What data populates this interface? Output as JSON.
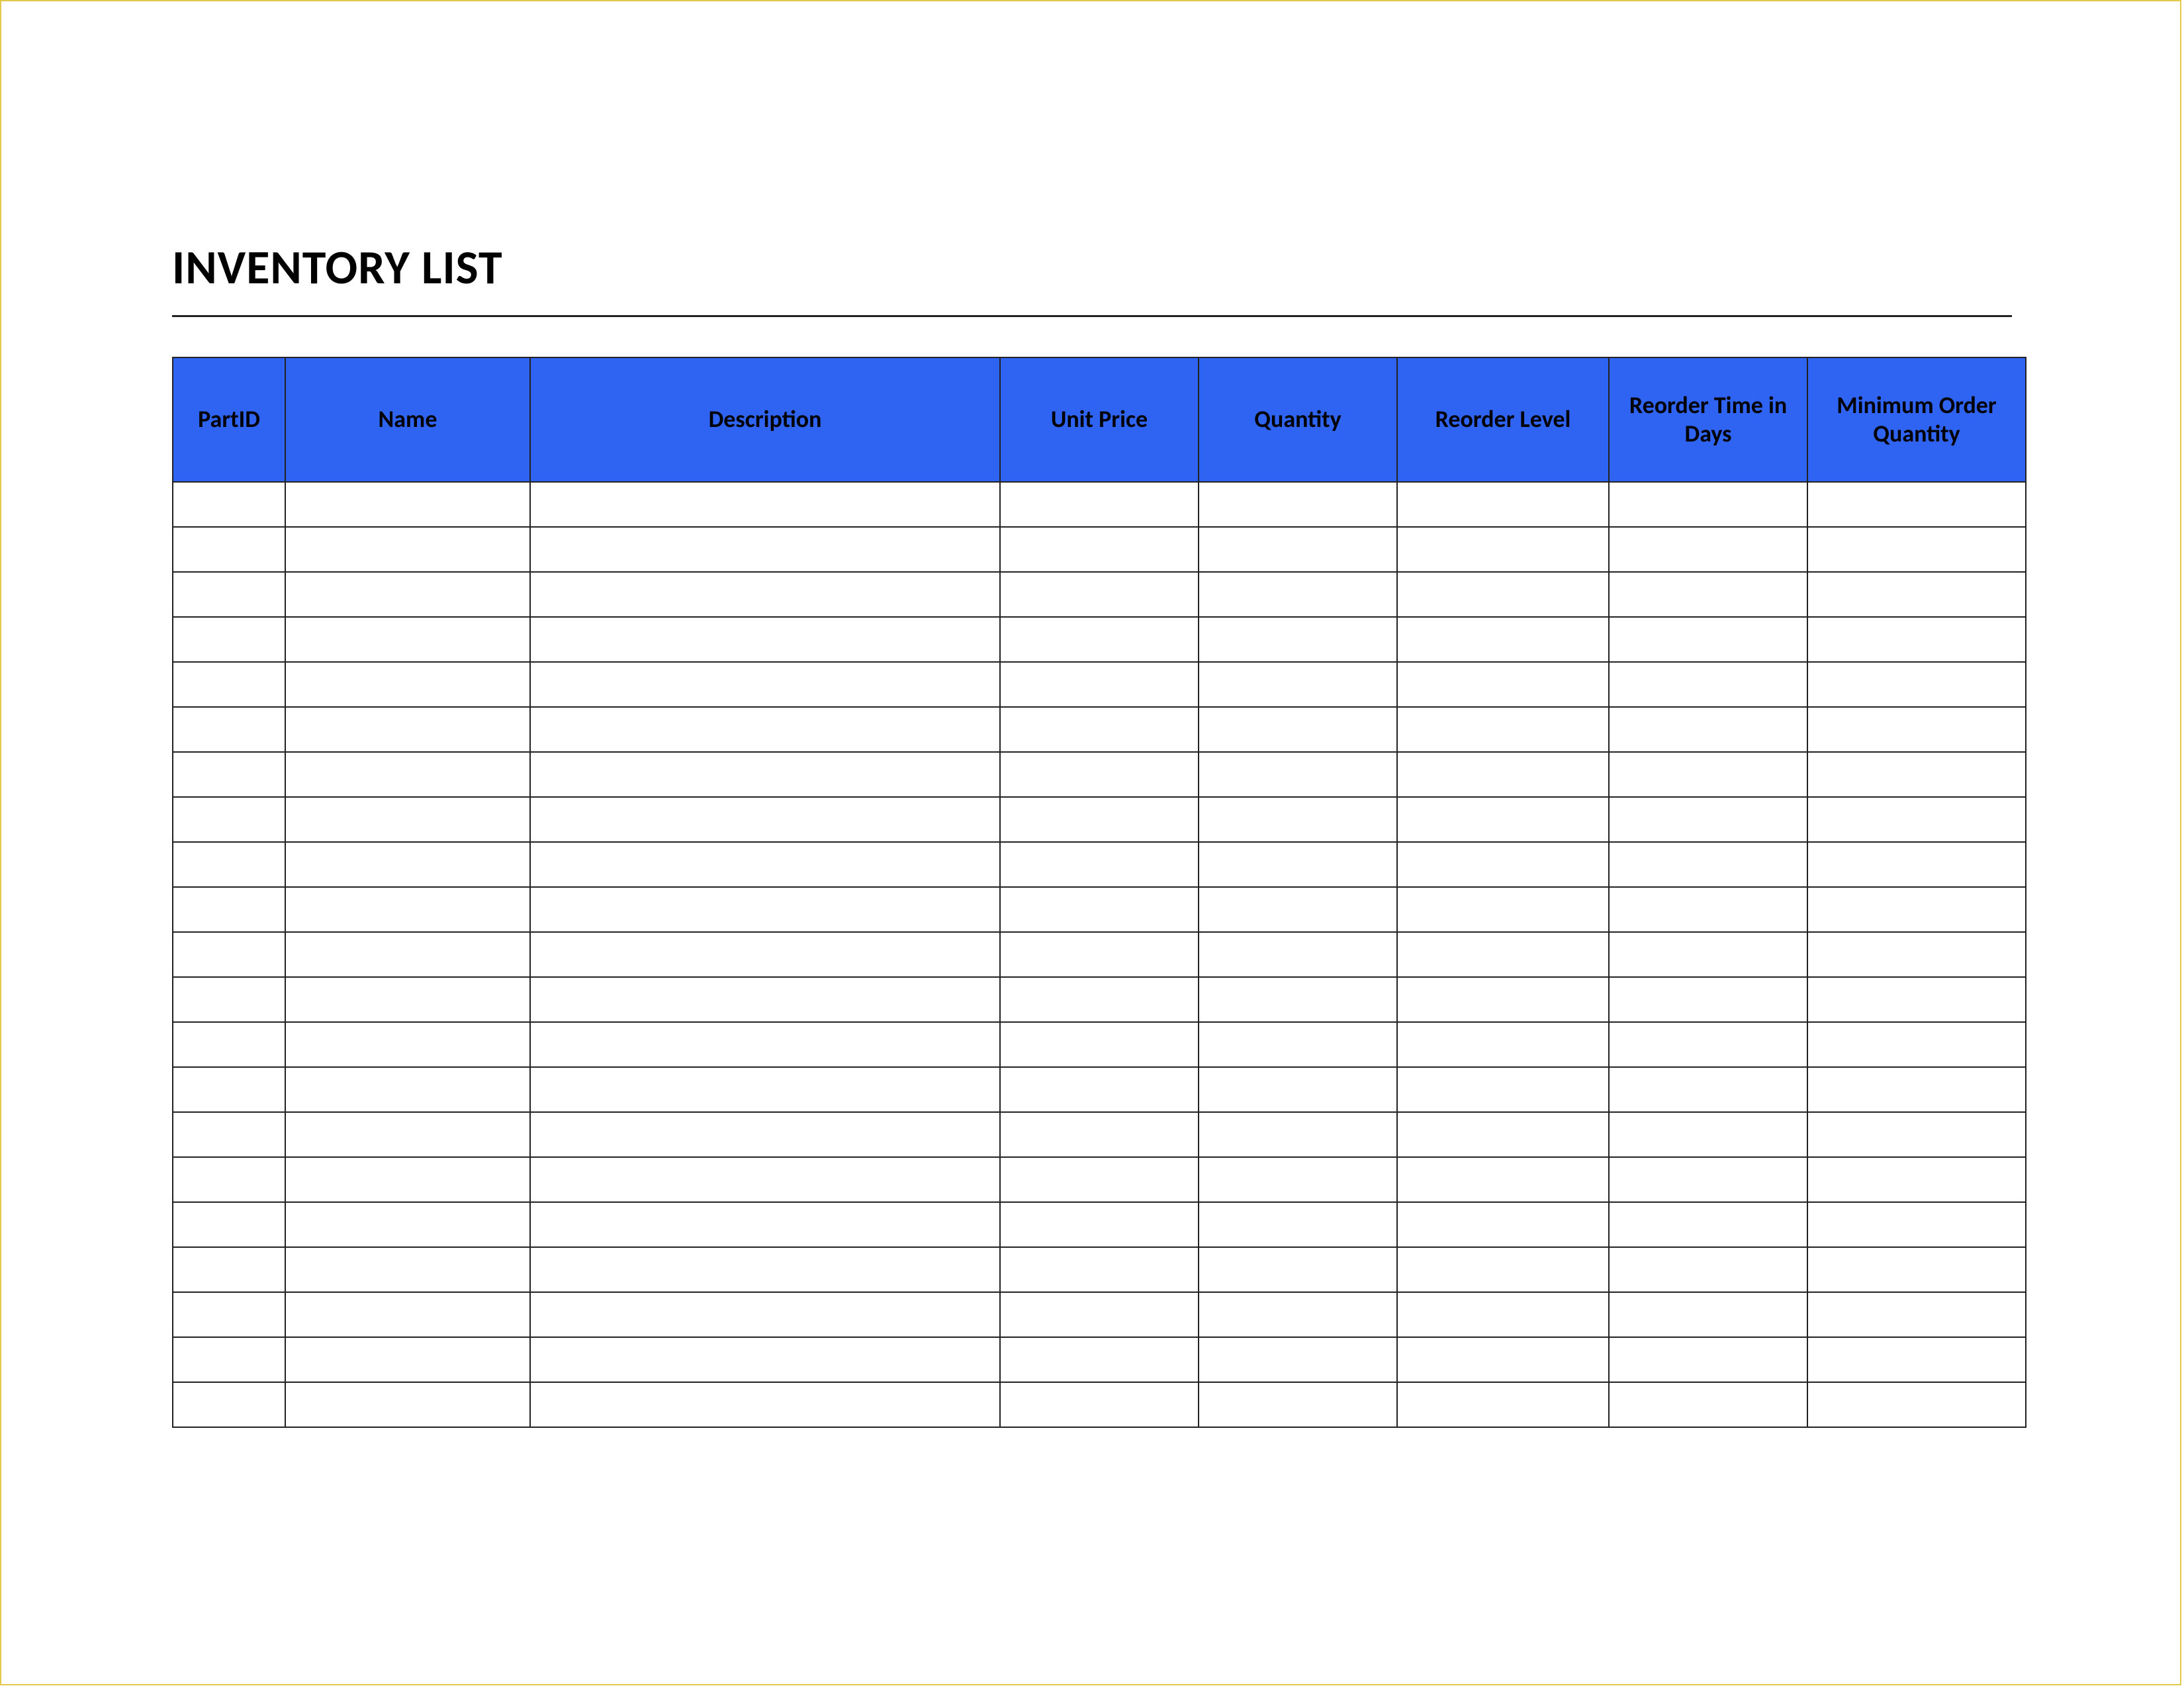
{
  "title": "INVENTORY LIST",
  "columns": [
    {
      "label": "PartID"
    },
    {
      "label": "Name"
    },
    {
      "label": "Description"
    },
    {
      "label": "Unit Price"
    },
    {
      "label": "Quantity"
    },
    {
      "label": "Reorder Level"
    },
    {
      "label": "Reorder Time in Days"
    },
    {
      "label": "Minimum Order Quantity"
    }
  ],
  "rows": [
    [
      "",
      "",
      "",
      "",
      "",
      "",
      "",
      ""
    ],
    [
      "",
      "",
      "",
      "",
      "",
      "",
      "",
      ""
    ],
    [
      "",
      "",
      "",
      "",
      "",
      "",
      "",
      ""
    ],
    [
      "",
      "",
      "",
      "",
      "",
      "",
      "",
      ""
    ],
    [
      "",
      "",
      "",
      "",
      "",
      "",
      "",
      ""
    ],
    [
      "",
      "",
      "",
      "",
      "",
      "",
      "",
      ""
    ],
    [
      "",
      "",
      "",
      "",
      "",
      "",
      "",
      ""
    ],
    [
      "",
      "",
      "",
      "",
      "",
      "",
      "",
      ""
    ],
    [
      "",
      "",
      "",
      "",
      "",
      "",
      "",
      ""
    ],
    [
      "",
      "",
      "",
      "",
      "",
      "",
      "",
      ""
    ],
    [
      "",
      "",
      "",
      "",
      "",
      "",
      "",
      ""
    ],
    [
      "",
      "",
      "",
      "",
      "",
      "",
      "",
      ""
    ],
    [
      "",
      "",
      "",
      "",
      "",
      "",
      "",
      ""
    ],
    [
      "",
      "",
      "",
      "",
      "",
      "",
      "",
      ""
    ],
    [
      "",
      "",
      "",
      "",
      "",
      "",
      "",
      ""
    ],
    [
      "",
      "",
      "",
      "",
      "",
      "",
      "",
      ""
    ],
    [
      "",
      "",
      "",
      "",
      "",
      "",
      "",
      ""
    ],
    [
      "",
      "",
      "",
      "",
      "",
      "",
      "",
      ""
    ],
    [
      "",
      "",
      "",
      "",
      "",
      "",
      "",
      ""
    ],
    [
      "",
      "",
      "",
      "",
      "",
      "",
      "",
      ""
    ],
    [
      "",
      "",
      "",
      "",
      "",
      "",
      "",
      ""
    ]
  ],
  "colors": {
    "header_bg": "#2f64f3",
    "border_outer": "#e3c84a",
    "border_table": "#222222"
  }
}
